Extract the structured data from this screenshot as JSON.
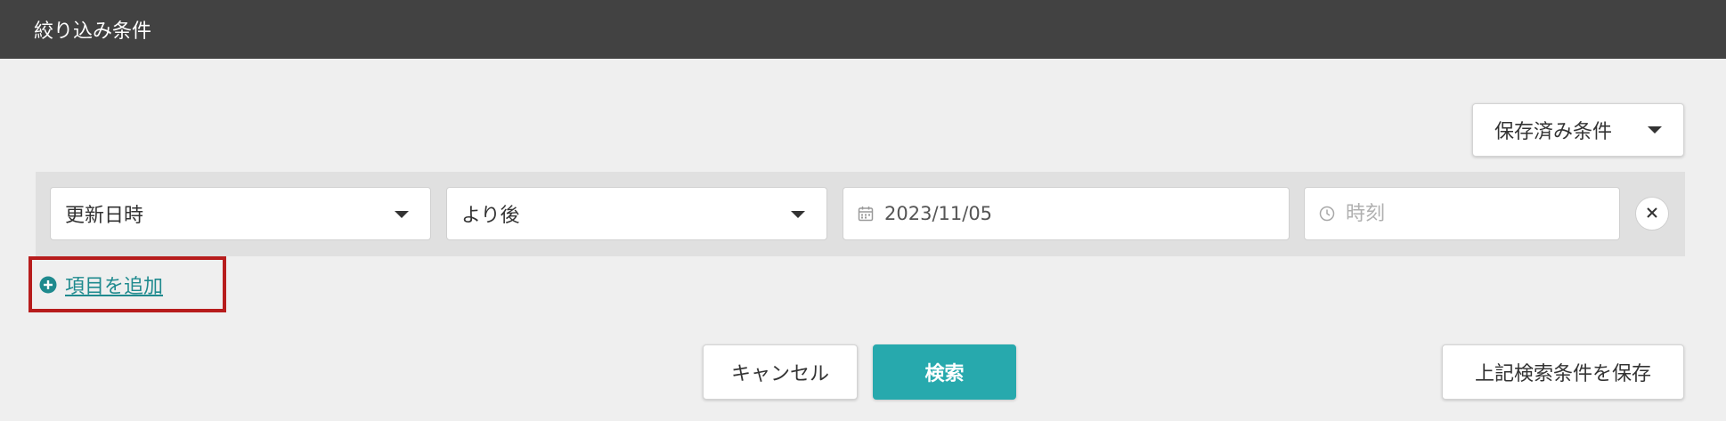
{
  "header": {
    "title": "絞り込み条件"
  },
  "saved_conditions": {
    "label": "保存済み条件",
    "icon": "chevron-down-icon"
  },
  "filter": {
    "field_value": "更新日時",
    "operator_value": "より後",
    "date_value": "2023/11/05",
    "time_placeholder": "時刻",
    "date_icon": "calendar-icon",
    "time_icon": "clock-icon",
    "remove_icon": "close-icon"
  },
  "add_item": {
    "label": "項目を追加",
    "icon": "plus-circle-icon",
    "color": "#1f8a8e",
    "highlight_color": "#b71c1c"
  },
  "actions": {
    "cancel_label": "キャンセル",
    "search_label": "検索",
    "save_label": "上記検索条件を保存",
    "primary_color": "#27a9ad"
  }
}
